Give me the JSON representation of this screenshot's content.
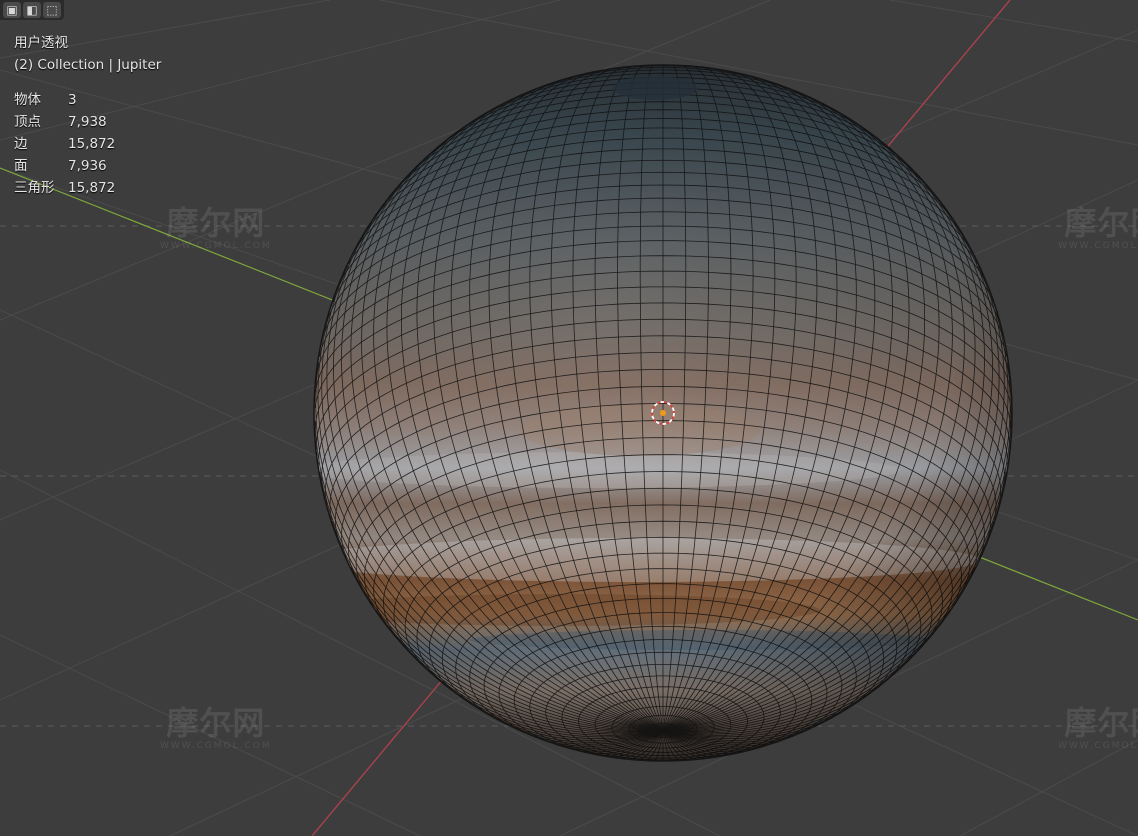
{
  "viewport": {
    "view_name": "用户透视",
    "collection_label": "(2) Collection | Jupiter"
  },
  "toolbar": {
    "buttons": [
      {
        "icon": "select-box-icon",
        "glyph": "▣"
      },
      {
        "icon": "select-extend-icon",
        "glyph": "◧"
      },
      {
        "icon": "select-subtract-icon",
        "glyph": "⬚"
      }
    ]
  },
  "stats": [
    {
      "label": "物体",
      "value": "3"
    },
    {
      "label": "顶点",
      "value": "7,938"
    },
    {
      "label": "边",
      "value": "15,872"
    },
    {
      "label": "面",
      "value": "7,936"
    },
    {
      "label": "三角形",
      "value": "15,872"
    }
  ],
  "watermark": {
    "main": "摩尔网",
    "sub": "WWW.CGMOL.COM"
  },
  "colors": {
    "background": "#3d3d3d",
    "grid_line": "#4a4a4a",
    "x_axis": "#b8424f",
    "y_axis": "#7ea83a",
    "wire": "#111111"
  }
}
